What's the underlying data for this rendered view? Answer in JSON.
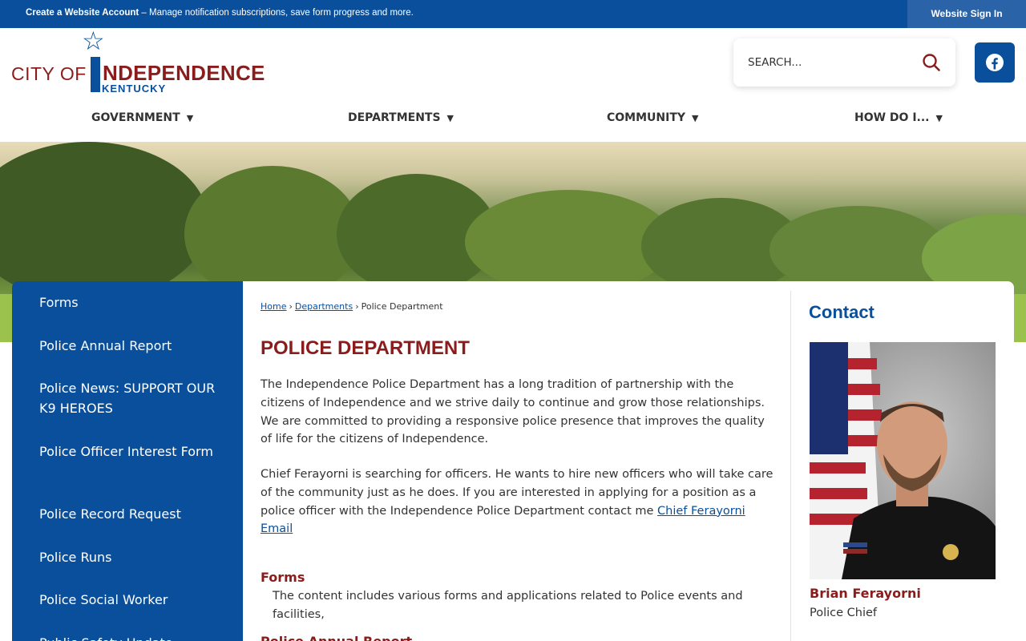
{
  "topbar": {
    "create_account": "Create a Website Account",
    "message": " – Manage notification subscriptions, save form progress and more.",
    "sign_in": "Website Sign In"
  },
  "logo": {
    "city_of": "CITY OF",
    "name_rest": "NDEPENDENCE",
    "state": "KENTUCKY"
  },
  "search": {
    "placeholder": "SEARCH..."
  },
  "nav": [
    {
      "label": "GOVERNMENT"
    },
    {
      "label": "DEPARTMENTS"
    },
    {
      "label": "COMMUNITY"
    },
    {
      "label": "HOW DO I..."
    }
  ],
  "sidebar": {
    "items": [
      {
        "label": "Forms"
      },
      {
        "label": "Police Annual Report"
      },
      {
        "label": "Police News:  SUPPORT OUR K9 HEROES"
      },
      {
        "label": "Police Officer Interest Form"
      },
      {
        "label": "Police Record Request"
      },
      {
        "label": "Police Runs"
      },
      {
        "label": "Police Social Worker"
      },
      {
        "label": "Public Safety Update"
      }
    ]
  },
  "breadcrumb": {
    "home": "Home",
    "departments": "Departments",
    "current": "Police Department",
    "sep": "›"
  },
  "main": {
    "title": "POLICE DEPARTMENT",
    "paragraph1": "The Independence Police Department has a long tradition of partnership with the citizens of Independence and we strive daily to continue and grow those relationships. We are committed to providing a responsive police presence that improves the quality of life for the citizens of Independence.",
    "paragraph2": "Chief Ferayorni is searching for officers.  He wants to hire new officers who will take care of the community just as he does.  If you are interested in applying for a position as a police officer with the Independence Police Department contact me ",
    "email_link": "Chief Ferayorni Email",
    "sections": [
      {
        "title": "Forms",
        "description": "The content includes various forms and applications related to Police events and facilities,"
      },
      {
        "title": "Police Annual Report",
        "description": ""
      }
    ]
  },
  "contact": {
    "heading": "Contact",
    "name": "Brian Ferayorni",
    "role": "Police Chief"
  },
  "colors": {
    "brand_blue": "#0a4f9c",
    "brand_red": "#8b1c1c"
  }
}
